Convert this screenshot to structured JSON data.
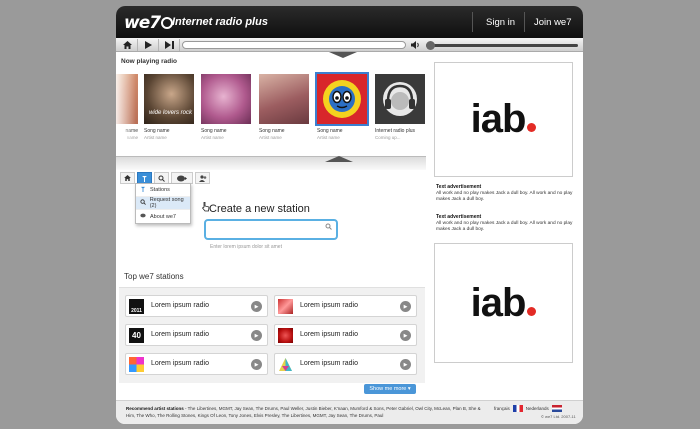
{
  "header": {
    "logo_text": "we7",
    "title": "Internet radio plus",
    "sign_in": "Sign in",
    "join": "Join we7"
  },
  "player": {
    "home_icon": "home-icon",
    "play_icon": "play-icon",
    "next_icon": "skip-forward-icon",
    "volume_icon": "speaker-icon",
    "progress": 0,
    "volume": 0
  },
  "now_playing": {
    "title": "Now playing radio",
    "cards": [
      {
        "name": "name",
        "artist": "name"
      },
      {
        "name": "Song name",
        "artist": "Artist name",
        "cover_caption": "wide lovers rock"
      },
      {
        "name": "Song name",
        "artist": "Artist name"
      },
      {
        "name": "Song name",
        "artist": "Artist name"
      },
      {
        "name": "Song name",
        "artist": "Artist name"
      },
      {
        "name": "Internet radio plus",
        "artist": "Coming up..."
      }
    ]
  },
  "subnav": {
    "menu": [
      {
        "label": "Stations",
        "icon": "antenna-icon"
      },
      {
        "label": "Request song (2)",
        "icon": "search-icon"
      },
      {
        "label": "About we7",
        "icon": "disc-icon"
      }
    ]
  },
  "create": {
    "title": "Create a new station",
    "placeholder": "",
    "hint": "Enter lorem ipsum dolor sit amet"
  },
  "top_stations": {
    "title": "Top we7 stations",
    "items": [
      {
        "label": "Lorem ipsum radio",
        "thumb": "2011"
      },
      {
        "label": "Lorem ipsum radio",
        "thumb": ""
      },
      {
        "label": "Lorem ipsum radio",
        "thumb": "40"
      },
      {
        "label": "Lorem ipsum radio",
        "thumb": ""
      },
      {
        "label": "Lorem ipsum radio",
        "thumb": ""
      },
      {
        "label": "Lorem ipsum radio",
        "thumb": ""
      }
    ],
    "show_more": "Show me more ▾"
  },
  "ads": {
    "logo_text": "iab",
    "text_ads": [
      {
        "title": "Text advertisement",
        "body": "All work and no play makes Jack a dull boy. All work and no play makes Jack a dull boy."
      },
      {
        "title": "Text advertisement",
        "body": "All work and no play makes Jack a dull boy. All work and no play makes Jack a dull boy."
      }
    ]
  },
  "footer": {
    "recommend_label": "Recommend artist stations",
    "recommend_list": " - The Libertines, MGMT, Jay Sean, The Drums, Paul Weller, Justin Bieber, K'naan, Mumford & Sons, Peter Gabriel, Owl City, McLean, Plan B, She & Him, The Who, The Rolling Stones, Kings Of Leon, Tony Jones, Elvis Presley, The Libertines, MGMT, Jay Sean, The Drums, Paul",
    "lang_fr": "français",
    "lang_nl": "Nederlands",
    "copyright": "© we7 Ltd. 2007-11"
  },
  "colors": {
    "accent": "#3a8fd8",
    "header_bg": "#1a1a1a",
    "iab_red": "#e32b25"
  }
}
